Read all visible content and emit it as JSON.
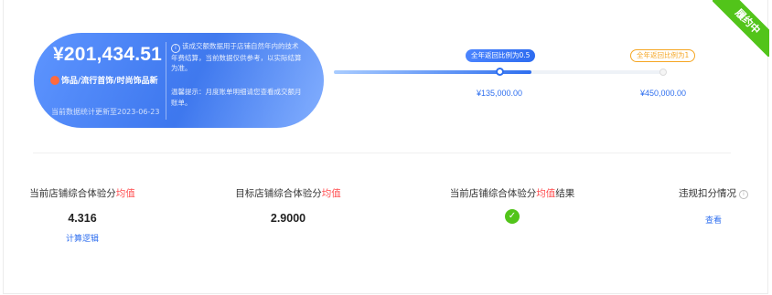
{
  "ribbon": {
    "label": "履约中"
  },
  "card": {
    "amount": "¥201,434.51",
    "category": "饰品/流行首饰/时尚饰品新",
    "update_note": "当前数据统计更新至2023-06-23",
    "info_text": "该成交额数据用于店铺自然年内的技术年费结算，当前数据仅供参考，以实际结算为准。",
    "tip_text": "温馨提示：月度账单明细请您查看成交额月账单。"
  },
  "progress": {
    "level_fraction": 0.5,
    "tag1": "全年返回比例为0.5",
    "tag2": "全年返回比例为1",
    "value1": "¥135,000.00",
    "value2": "¥450,000.00",
    "fill_color": "#2f6fef"
  },
  "metrics": [
    {
      "label_prefix": "当前店铺综合体验分",
      "label_highlight": "均值",
      "label_suffix": "",
      "value": "4.316",
      "link": "计算逻辑"
    },
    {
      "label_prefix": "目标店铺综合体验分",
      "label_highlight": "均值",
      "label_suffix": "",
      "value": "2.9000"
    },
    {
      "label_prefix": "当前店铺综合体验分",
      "label_highlight": "均值",
      "label_suffix": "结果",
      "status_icon": "check-circle-icon"
    },
    {
      "label_prefix": "违规扣分情况",
      "link": "查看",
      "info_icon": "info-icon"
    }
  ],
  "colors": {
    "accent": "#2f6fef",
    "highlight": "#ff4d4f",
    "success": "#52c41a",
    "warning": "#f5a623"
  }
}
